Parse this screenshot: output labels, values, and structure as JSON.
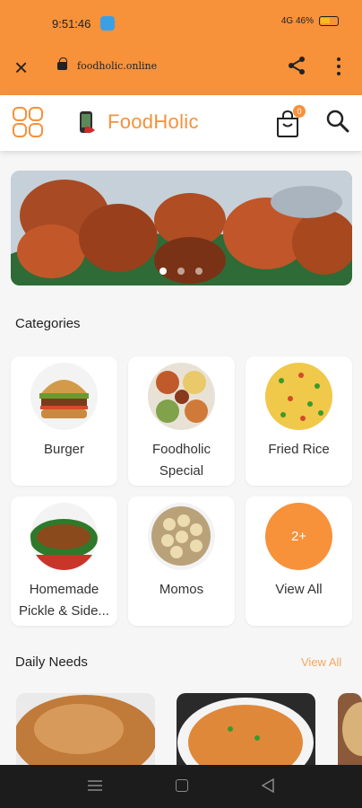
{
  "status_bar": {
    "time": "9:51:46",
    "right_text": "4G  46%"
  },
  "browser": {
    "url": "foodholic.online"
  },
  "header": {
    "brand": "FoodHolic",
    "cart_count": "0"
  },
  "categories": {
    "title": "Categories",
    "items": [
      {
        "label": "Burger"
      },
      {
        "label": "Foodholic Special"
      },
      {
        "label": "Fried Rice"
      },
      {
        "label": "Homemade Pickle & Side..."
      },
      {
        "label": "Momos"
      },
      {
        "label": "View All",
        "badge": "2+"
      }
    ]
  },
  "daily_needs": {
    "title": "Daily Needs",
    "view_all": "View All"
  },
  "colors": {
    "accent": "#f7913a",
    "nav": "#1c1c1c"
  }
}
